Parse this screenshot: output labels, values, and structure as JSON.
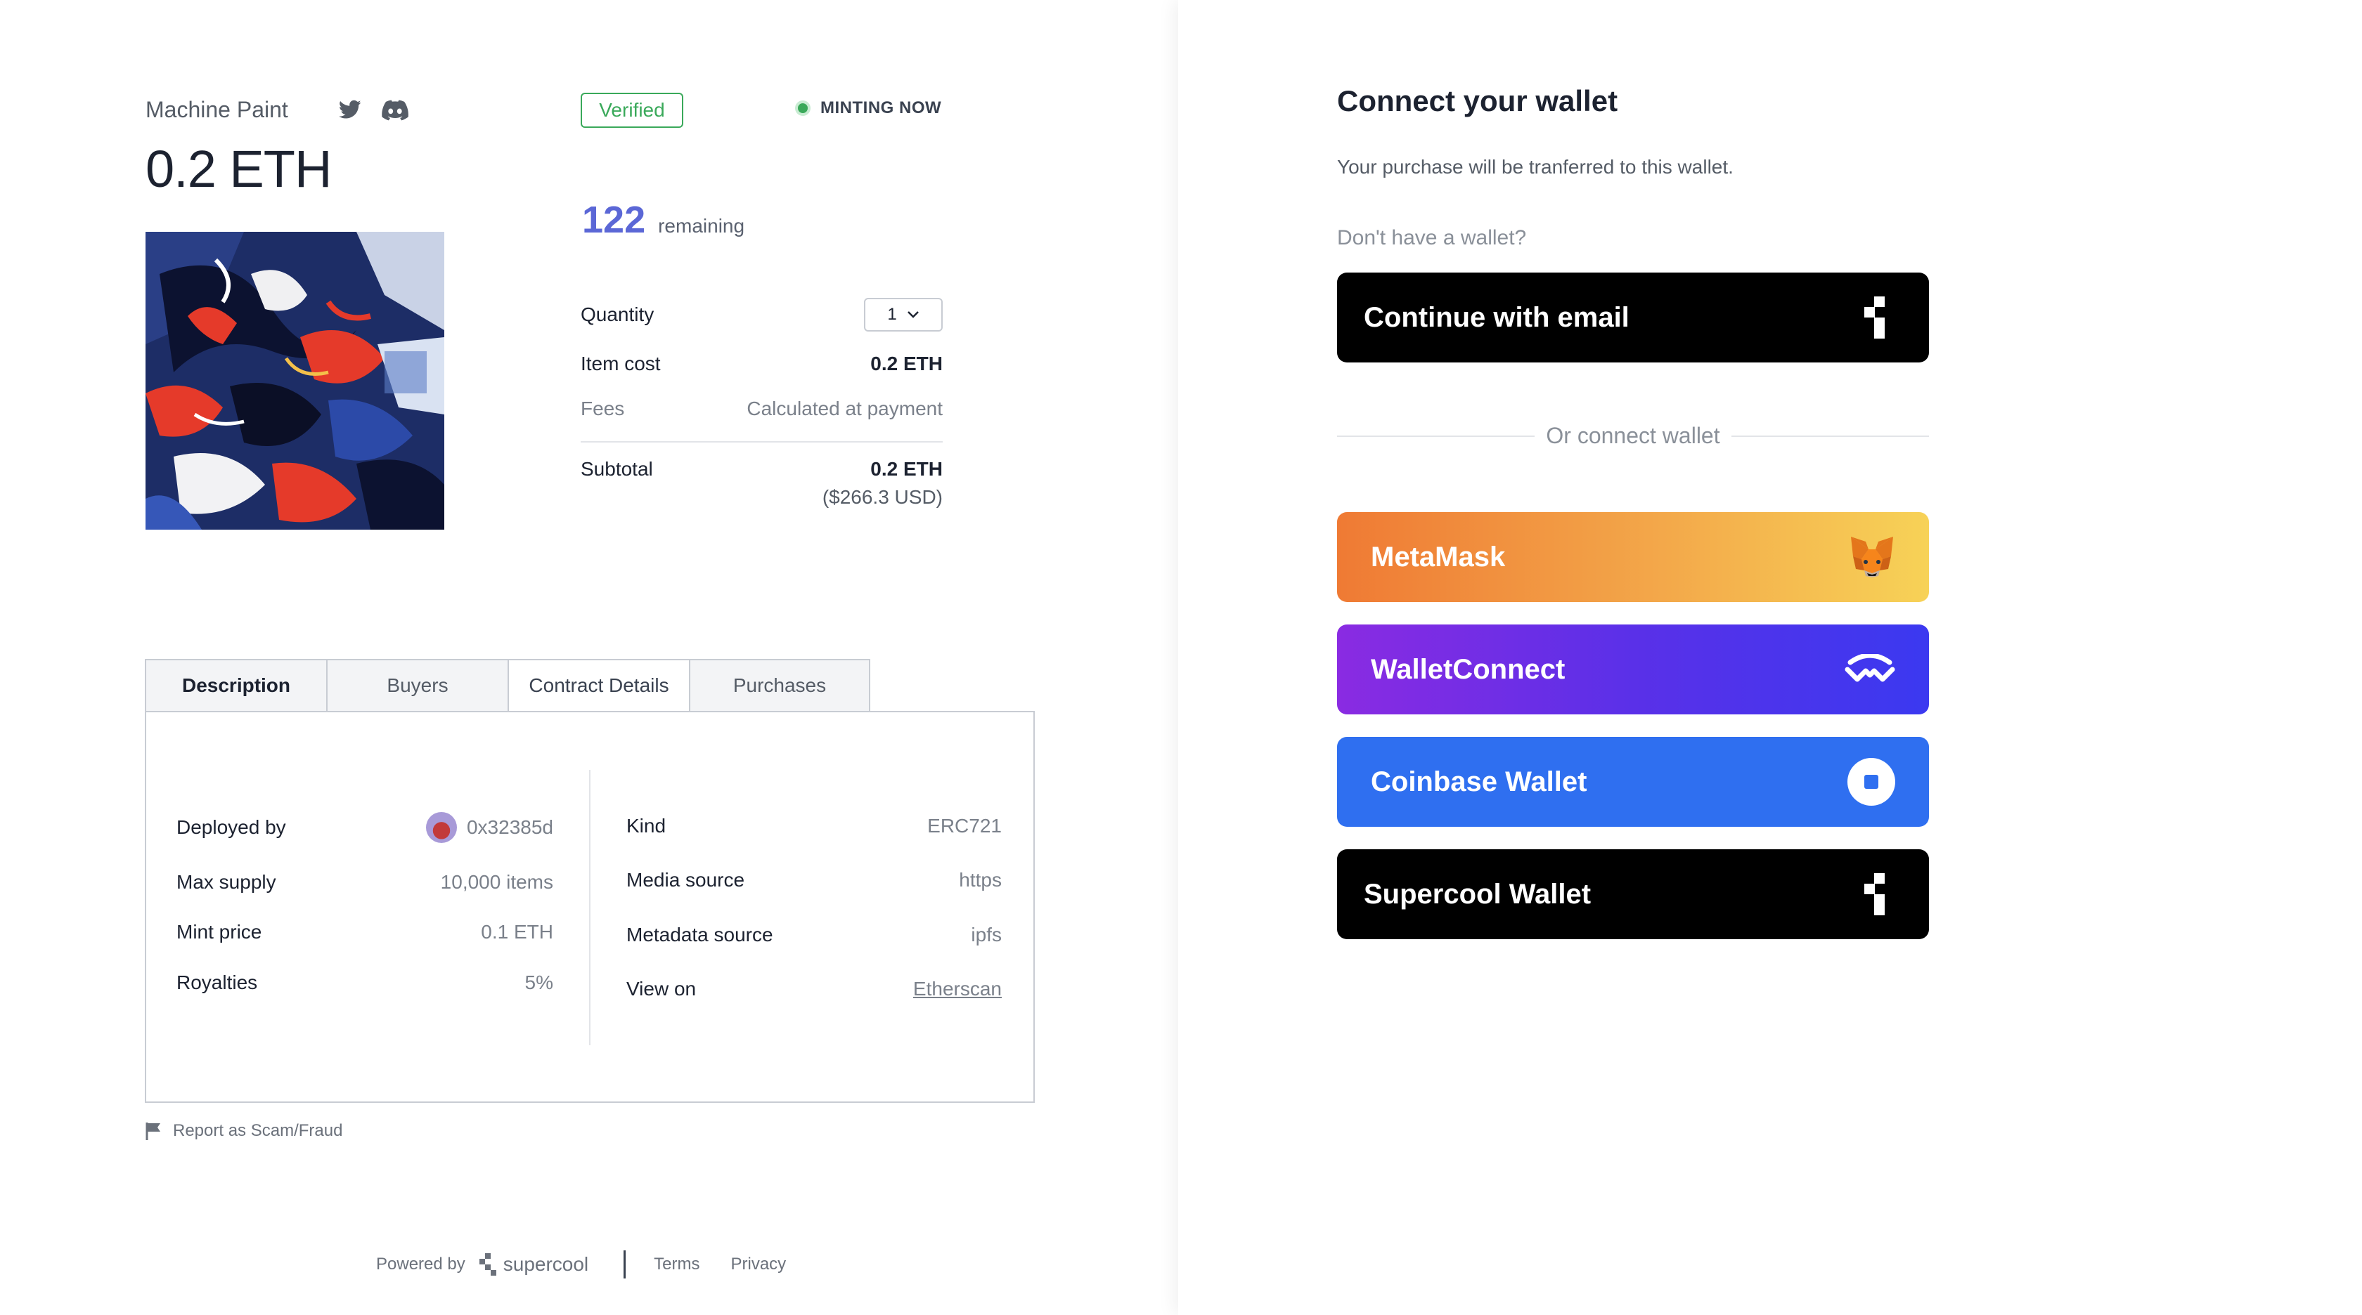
{
  "collection": {
    "name": "Machine Paint",
    "price": "0.2 ETH",
    "verified_label": "Verified",
    "status_label": "MINTING NOW"
  },
  "mint": {
    "remaining_count": "122",
    "remaining_label": "remaining",
    "quantity_label": "Quantity",
    "quantity_value": "1",
    "item_cost_label": "Item cost",
    "item_cost_value": "0.2 ETH",
    "fees_label": "Fees",
    "fees_value": "Calculated at payment",
    "subtotal_label": "Subtotal",
    "subtotal_value": "0.2 ETH",
    "subtotal_usd": "($266.3 USD)"
  },
  "tabs": [
    {
      "label": "Description"
    },
    {
      "label": "Buyers"
    },
    {
      "label": "Contract Details"
    },
    {
      "label": "Purchases"
    }
  ],
  "contract": {
    "left": [
      {
        "label": "Deployed by",
        "value": "0x32385d"
      },
      {
        "label": "Max supply",
        "value": "10,000 items"
      },
      {
        "label": "Mint price",
        "value": "0.1 ETH"
      },
      {
        "label": "Royalties",
        "value": "5%"
      }
    ],
    "right": [
      {
        "label": "Kind",
        "value": "ERC721"
      },
      {
        "label": "Media source",
        "value": "https"
      },
      {
        "label": "Metadata source",
        "value": "ipfs"
      },
      {
        "label": "View on",
        "value": "Etherscan"
      }
    ]
  },
  "report_label": "Report as Scam/Fraud",
  "footer": {
    "powered_by": "Powered by",
    "brand": "supercool",
    "terms": "Terms",
    "privacy": "Privacy"
  },
  "wallet": {
    "title": "Connect your wallet",
    "subtitle": "Your purchase will be tranferred to this wallet.",
    "no_wallet": "Don't have a wallet?",
    "email_button": "Continue with email",
    "or_connect": "Or connect wallet",
    "metamask": "MetaMask",
    "walletconnect": "WalletConnect",
    "coinbase": "Coinbase Wallet",
    "supercool": "Supercool Wallet"
  },
  "icons": {
    "twitter": "twitter-icon",
    "discord": "discord-icon",
    "chevron": "chevron-down-icon",
    "flag": "flag-icon",
    "supercool_logo": "supercool-logo-icon",
    "fox": "metamask-fox-icon",
    "walletconnect": "walletconnect-icon",
    "coinbase": "coinbase-icon"
  },
  "colors": {
    "verified": "#3aa95a",
    "remaining": "#5b67d6",
    "metamask_start": "#ef7a34",
    "metamask_end": "#f7d257",
    "walletconnect_start": "#8a2be2",
    "walletconnect_end": "#3b39f0",
    "coinbase": "#2f6ff0"
  }
}
